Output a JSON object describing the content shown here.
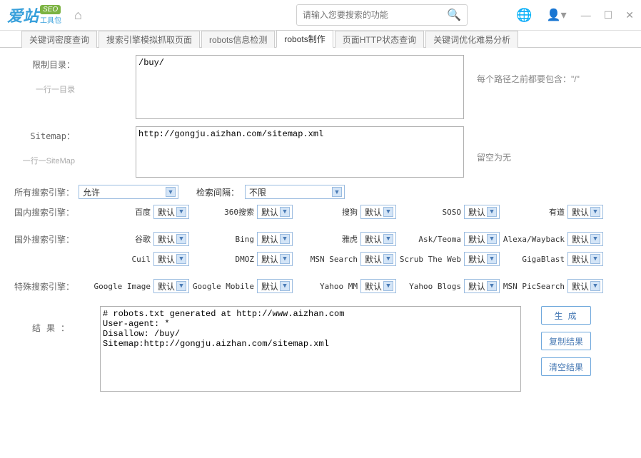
{
  "app": {
    "logo_main": "爱站",
    "logo_seo": "SEO",
    "logo_sub": "工具包",
    "search_placeholder": "请输入您要搜索的功能"
  },
  "tabs": {
    "t0": "关键词密度查询",
    "t1": "搜索引擎模拟抓取页面",
    "t2": "robots信息检测",
    "t3": "robots制作",
    "t4": "页面HTTP状态查询",
    "t5": "关键词优化难易分析"
  },
  "form": {
    "restrict_label": "限制目录：",
    "restrict_sub": "一行一目录",
    "restrict_value": "/buy/",
    "restrict_hint": "每个路径之前都要包含：\"/\"",
    "sitemap_label": "Sitemap：",
    "sitemap_sub": "一行一SiteMap",
    "sitemap_value": "http://gongju.aizhan.com/sitemap.xml",
    "sitemap_hint": "留空为无",
    "all_engines_label": "所有搜索引擎：",
    "all_engines_value": "允许",
    "interval_label": "检索间隔：",
    "interval_value": "不限",
    "domestic_label": "国内搜索引擎：",
    "foreign_label": "国外搜索引擎：",
    "special_label": "特殊搜索引擎：",
    "default": "默认",
    "domestic": {
      "e0": "百度",
      "e1": "360搜索",
      "e2": "搜狗",
      "e3": "SOSO",
      "e4": "有道"
    },
    "foreign": {
      "e0": "谷歌",
      "e1": "Bing",
      "e2": "雅虎",
      "e3": "Ask/Teoma",
      "e4": "Alexa/Wayback",
      "e5": "Cuil",
      "e6": "DMOZ",
      "e7": "MSN Search",
      "e8": "Scrub The Web",
      "e9": "GigaBlast"
    },
    "special": {
      "e0": "Google Image",
      "e1": "Google Mobile",
      "e2": "Yahoo MM",
      "e3": "Yahoo Blogs",
      "e4": "MSN PicSearch"
    },
    "result_label": "结果：",
    "result_value": "# robots.txt generated at http://www.aizhan.com\nUser-agent: *\nDisallow: /buy/\nSitemap:http://gongju.aizhan.com/sitemap.xml",
    "btn_generate": "生 成",
    "btn_copy": "复制结果",
    "btn_clear": "清空结果"
  }
}
